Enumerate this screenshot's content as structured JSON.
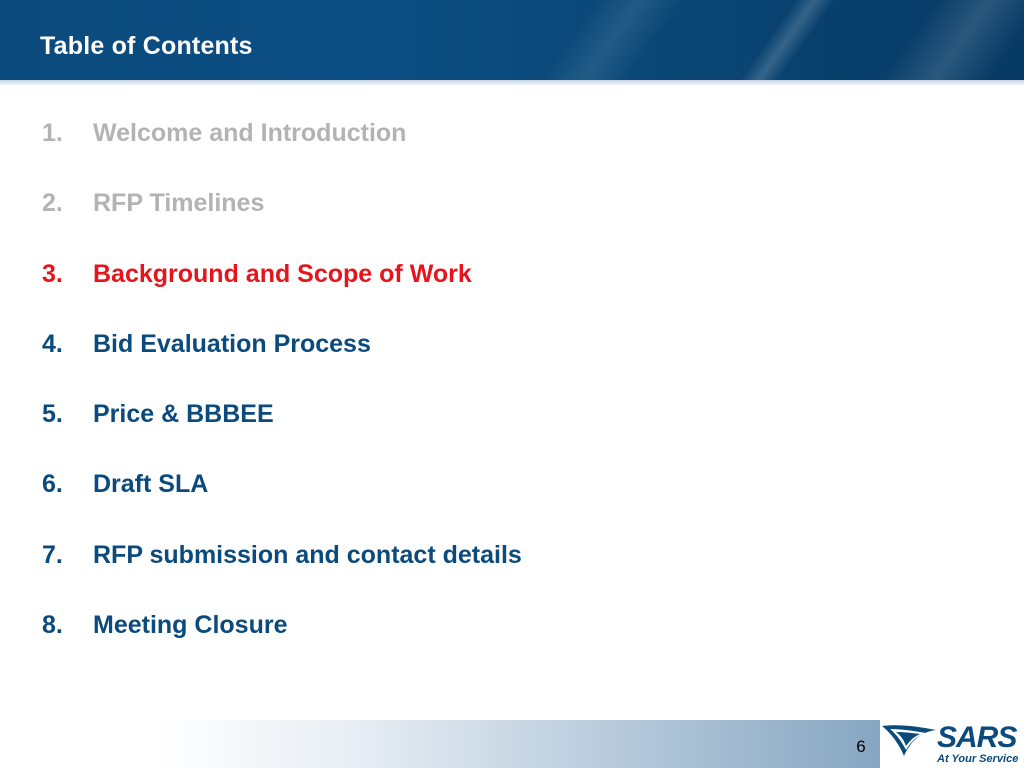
{
  "header": {
    "title": "Table of Contents"
  },
  "toc": {
    "items": [
      {
        "number": "1.",
        "label": "Welcome and Introduction",
        "status": "done"
      },
      {
        "number": "2.",
        "label": "RFP Timelines",
        "status": "done"
      },
      {
        "number": "3.",
        "label": "Background and Scope of Work",
        "status": "current"
      },
      {
        "number": "4.",
        "label": "Bid Evaluation Process",
        "status": "upcoming"
      },
      {
        "number": "5.",
        "label": "Price & BBBEE",
        "status": "upcoming"
      },
      {
        "number": "6.",
        "label": "Draft SLA",
        "status": "upcoming"
      },
      {
        "number": "7.",
        "label": "RFP submission and contact details",
        "status": "upcoming"
      },
      {
        "number": "8.",
        "label": "Meeting Closure",
        "status": "upcoming"
      }
    ]
  },
  "footer": {
    "page_number": "6",
    "logo": {
      "wordmark": "SARS",
      "tagline": "At Your Service",
      "icon": "sars-swoosh-logo"
    }
  },
  "colors": {
    "brand_blue": "#0b4a7c",
    "done_gray": "#b3b3b3",
    "current_red": "#e8141c"
  }
}
